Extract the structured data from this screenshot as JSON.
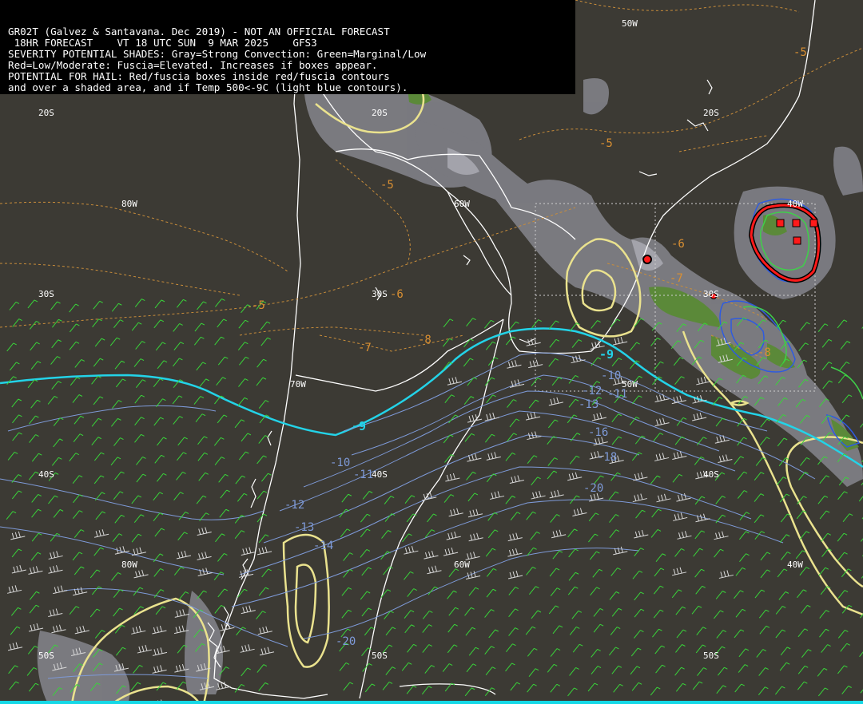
{
  "header": {
    "lines": [
      "GR02T (Galvez & Santavana. Dec 2019) - NOT AN OFFICIAL FORECAST",
      " 18HR FORECAST    VT 18 UTC SUN  9 MAR 2025    GFS3",
      "SEVERITY POTENTIAL SHADES: Gray=Strong Convection: Green=Marginal/Low",
      "Red=Low/Moderate: Fuscia=Elevated. Increases if boxes appear.",
      "POTENTIAL FOR HAIL: Red/fuscia boxes inside red/fuscia contours",
      "and over a shaded area, and if Temp 500<-9C (light blue contours)."
    ]
  },
  "colors": {
    "background": "#3c3a34",
    "coastline": "#ffffff",
    "gray_shade": "#8a8a90",
    "green_shade": "#5f8f3a",
    "yellow_contour": "#eae28e",
    "orange_contour": "#c98d3a",
    "cyan_contour": "#23d3e8",
    "blue_contour": "#7e9ad8",
    "red_contour": "#ff1a1a",
    "wind_barbs": "#39d43a"
  },
  "grid_labels": {
    "lon": [
      "50W",
      "80W",
      "60W",
      "40W",
      "70W",
      "50W",
      "80W",
      "60W",
      "40W"
    ],
    "lat": [
      "20S",
      "20S",
      "20S",
      "30S",
      "30S",
      "30S",
      "40S",
      "40S",
      "40S",
      "50S",
      "50S",
      "50S"
    ]
  },
  "contour_labels": {
    "orange": [
      "-5",
      "-5",
      "-5",
      "-6",
      "-6",
      "-5",
      "-7",
      "-7",
      "-8",
      "-8"
    ],
    "cyan": [
      "-9",
      "-9"
    ],
    "blue": [
      "-10",
      "-11",
      "-12",
      "-13",
      "-16",
      "-18",
      "-20",
      "-10",
      "-11",
      "-12",
      "-13",
      "-14",
      "-20"
    ]
  }
}
